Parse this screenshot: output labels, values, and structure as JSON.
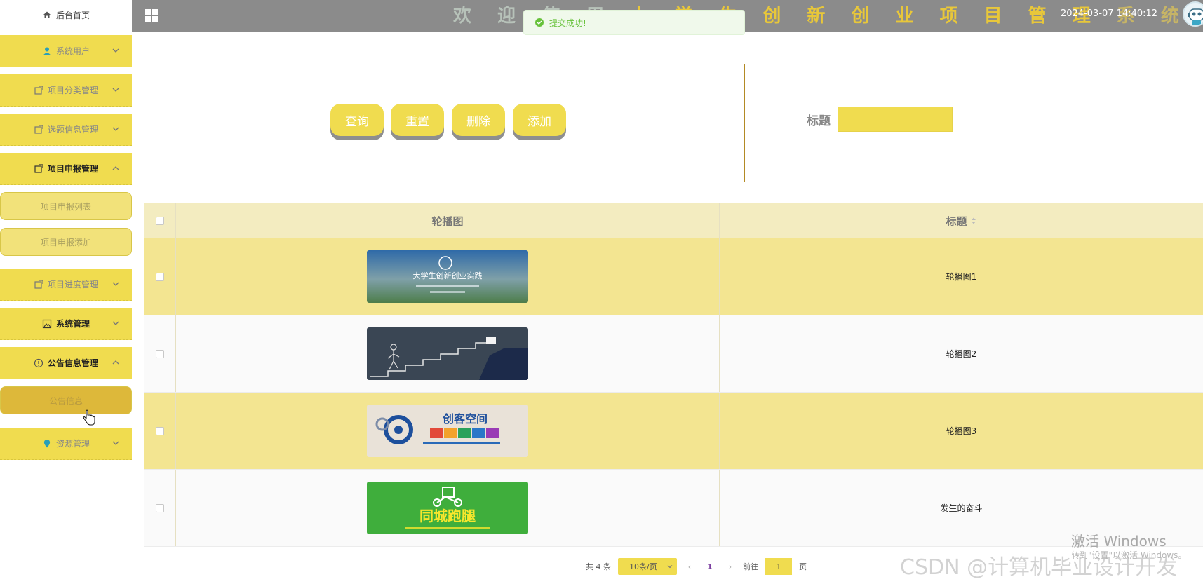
{
  "sidebar": {
    "home": "后台首页",
    "menus": [
      {
        "label": "系统用户",
        "icon": "user-icon"
      },
      {
        "label": "项目分类管理",
        "icon": "doc-icon"
      },
      {
        "label": "选题信息管理",
        "icon": "doc-icon"
      },
      {
        "label": "项目申报管理",
        "icon": "doc-icon",
        "expanded": true
      },
      {
        "label": "项目进度管理",
        "icon": "doc-icon"
      },
      {
        "label": "系统管理",
        "icon": "picture-icon"
      },
      {
        "label": "公告信息管理",
        "icon": "info-icon",
        "expanded": true
      },
      {
        "label": "资源管理",
        "icon": "pin-icon"
      }
    ],
    "submenus": {
      "project_apply": [
        "项目申报列表",
        "项目申报添加"
      ],
      "notice": [
        "公告信息"
      ]
    }
  },
  "header": {
    "title_parts": [
      "欢 迎 使 用 ",
      "大 学 生 创 新 创 业 项 目 管 理 ",
      "系 统"
    ],
    "datetime": "2024-03-07 14:40:12"
  },
  "toast": {
    "message": "提交成功!"
  },
  "search": {
    "buttons": [
      "查询",
      "重置",
      "删除",
      "添加"
    ],
    "field_label": "标题",
    "field_value": ""
  },
  "table": {
    "headers": [
      "轮播图",
      "标题"
    ],
    "rows": [
      {
        "title": "轮播图1",
        "image": "campus-banner"
      },
      {
        "title": "轮播图2",
        "image": "chalkboard-stairs"
      },
      {
        "title": "轮播图3",
        "image": "maker-space"
      },
      {
        "title": "发生的奋斗",
        "image": "delivery-green"
      }
    ]
  },
  "thumb_text": {
    "row1": "大学生创新创业实践",
    "row3_a": "创客空间",
    "row4_a": "同城跑腿"
  },
  "pagination": {
    "total": "共 4 条",
    "page_size": "10条/页",
    "current_page": "1",
    "goto_prefix": "前往",
    "goto_value": "1",
    "goto_suffix": "页"
  },
  "watermarks": {
    "windows_line1": "激活 Windows",
    "windows_line2": "转到\"设置\"以激活 Windows。",
    "csdn": "CSDN @计算机毕业设计开发"
  },
  "colors": {
    "accent": "#f0dc4f",
    "header": "#8b8b8b",
    "success": "#67c23a",
    "divider": "#b38a24"
  }
}
